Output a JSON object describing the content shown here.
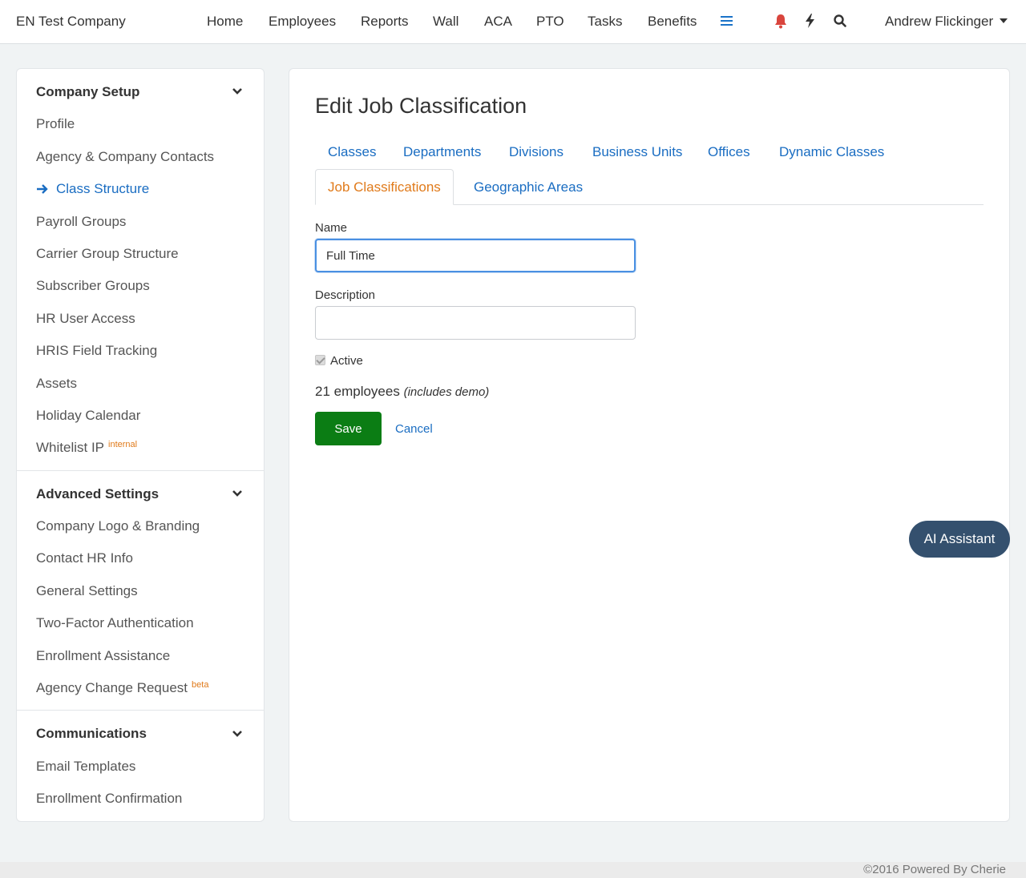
{
  "header": {
    "brand": "EN Test Company",
    "nav": [
      "Home",
      "Employees",
      "Reports",
      "Wall",
      "ACA",
      "PTO",
      "Tasks",
      "Benefits"
    ],
    "user": "Andrew Flickinger"
  },
  "sidebar": {
    "sections": [
      {
        "title": "Company Setup",
        "items": [
          "Profile",
          "Agency & Company Contacts",
          "Class Structure",
          "Payroll Groups",
          "Carrier Group Structure",
          "Subscriber Groups",
          "HR User Access",
          "HRIS Field Tracking",
          "Assets",
          "Holiday Calendar",
          "Whitelist IP"
        ]
      },
      {
        "title": "Advanced Settings",
        "items": [
          "Company Logo & Branding",
          "Contact HR Info",
          "General Settings",
          "Two-Factor Authentication",
          "Enrollment Assistance",
          "Agency Change Request"
        ]
      },
      {
        "title": "Communications",
        "items": [
          "Email Templates",
          "Enrollment Confirmation"
        ]
      }
    ],
    "whitelist_badge": "internal",
    "agency_change_badge": "beta",
    "active_item": "Class Structure"
  },
  "main": {
    "title": "Edit Job Classification",
    "tabs": [
      "Classes",
      "Departments",
      "Divisions",
      "Business Units",
      "Offices",
      "Dynamic Classes",
      "Job Classifications",
      "Geographic Areas"
    ],
    "active_tab": "Job Classifications",
    "form": {
      "name_label": "Name",
      "name_value": "Full Time",
      "description_label": "Description",
      "description_value": "",
      "active_label": "Active",
      "active_checked": true,
      "count_text": "21 employees",
      "count_note": "(includes demo)",
      "save_label": "Save",
      "cancel_label": "Cancel"
    }
  },
  "ai_assistant_label": "AI Assistant",
  "footer": "©2016 Powered By Cherie",
  "colors": {
    "link": "#1a6dc2",
    "active_tab": "#e07a1a",
    "save": "#0b7d14",
    "ai_button": "#34506e",
    "bell": "#d9453d"
  }
}
